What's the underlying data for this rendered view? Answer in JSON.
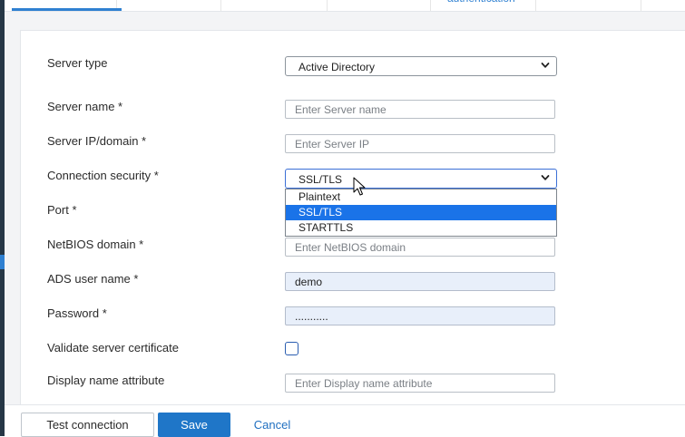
{
  "tabs": {
    "clipped_label": "authentication"
  },
  "form": {
    "server_type": {
      "label": "Server type",
      "value": "Active Directory"
    },
    "server_name": {
      "label": "Server name *",
      "placeholder": "Enter Server name",
      "value": ""
    },
    "server_ip": {
      "label": "Server IP/domain *",
      "placeholder": "Enter Server IP",
      "value": ""
    },
    "connection_security": {
      "label": "Connection security *",
      "value": "SSL/TLS",
      "options": [
        "Plaintext",
        "SSL/TLS",
        "STARTTLS"
      ],
      "selected_option": "SSL/TLS"
    },
    "port": {
      "label": "Port *"
    },
    "netbios": {
      "label": "NetBIOS domain *",
      "placeholder": "Enter NetBIOS domain",
      "value": ""
    },
    "ads_user": {
      "label": "ADS user name *",
      "value": "demo"
    },
    "password": {
      "label": "Password *",
      "value": "..........."
    },
    "validate_cert": {
      "label": "Validate server certificate",
      "checked": false
    },
    "display_name": {
      "label": "Display name attribute",
      "placeholder": "Enter Display name attribute",
      "value": ""
    }
  },
  "footer": {
    "test_label": "Test connection",
    "save_label": "Save",
    "cancel_label": "Cancel"
  },
  "colors": {
    "accent": "#1f76c8",
    "selected_option": "#1a73e8",
    "filled_field": "#e8effa"
  }
}
